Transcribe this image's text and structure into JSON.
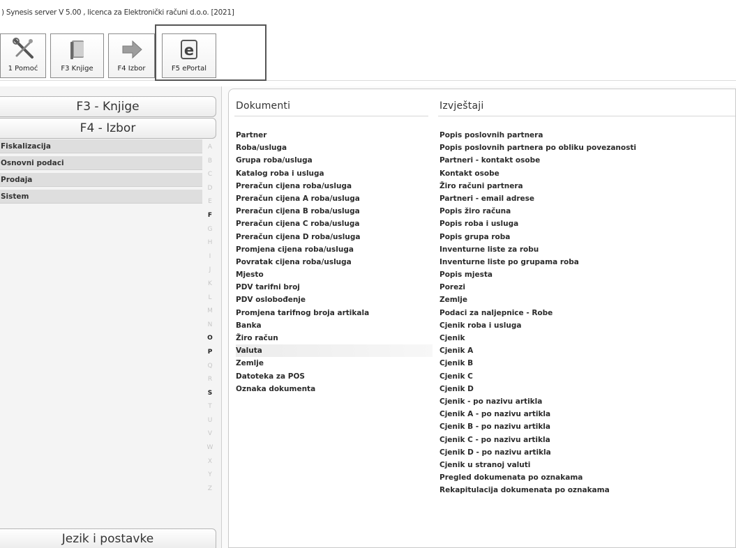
{
  "window": {
    "title": ") Synesis server V 5.00 , licenca za Elektronički računi d.o.o. [2021]"
  },
  "toolbar": {
    "buttons": [
      {
        "label": "1 Pomoć",
        "icon": "wrench-icon"
      },
      {
        "label": "F3 Knjige",
        "icon": "book-icon"
      },
      {
        "label": "F4 Izbor",
        "icon": "arrow-right-icon"
      },
      {
        "label": "F5 ePortal",
        "icon": "eportal-icon"
      }
    ]
  },
  "sidebar": {
    "tab_f3": "F3 - Knjige",
    "tab_f4": "F4 - Izbor",
    "items": [
      {
        "label": "Fiskalizacija"
      },
      {
        "label": "Osnovni podaci"
      },
      {
        "label": "Prodaja"
      },
      {
        "label": "Sistem"
      }
    ],
    "alphabet": [
      "A",
      "B",
      "C",
      "D",
      "E",
      "F",
      "G",
      "H",
      "I",
      "J",
      "K",
      "L",
      "M",
      "N",
      "O",
      "P",
      "Q",
      "R",
      "S",
      "T",
      "U",
      "V",
      "W",
      "X",
      "Y",
      "Z"
    ],
    "active_letters": [
      "F",
      "O",
      "P",
      "S"
    ],
    "bottom_tab": "Jezik i postavke"
  },
  "dokumenti": {
    "heading": "Dokumenti",
    "selected_index": 17,
    "items": [
      "Partner",
      "Roba/usluga",
      "Grupa roba/usluga",
      "Katalog roba i usluga",
      "Preračun cijena roba/usluga",
      "Preračun cijena A roba/usluga",
      "Preračun cijena B roba/usluga",
      "Preračun cijena C roba/usluga",
      "Preračun cijena D roba/usluga",
      "Promjena cijena roba/usluga",
      "Povratak cijena roba/usluga",
      "Mjesto",
      "PDV tarifni broj",
      "PDV oslobođenje",
      "Promjena tarifnog broja artikala",
      "Banka",
      "Žiro račun",
      "Valuta",
      "Zemlje",
      "Datoteka za POS",
      "Oznaka dokumenta"
    ]
  },
  "izvjestaji": {
    "heading": "Izvještaji",
    "items": [
      "Popis poslovnih partnera",
      "Popis poslovnih partnera po obliku povezanosti",
      "Partneri - kontakt osobe",
      "Kontakt osobe",
      "Žiro računi partnera",
      "Partneri - email adrese",
      "Popis žiro računa",
      "Popis roba i usluga",
      "Popis grupa roba",
      "Inventurne liste za robu",
      "Inventurne liste po grupama roba",
      "Popis mjesta",
      "Porezi",
      "Zemlje",
      "Podaci za naljepnice - Robe",
      "Cjenik roba i usluga",
      "Cjenik",
      "Cjenik A",
      "Cjenik B",
      "Cjenik C",
      "Cjenik D",
      "Cjenik - po nazivu artikla",
      "Cjenik A - po nazivu artikla",
      "Cjenik B - po nazivu artikla",
      "Cjenik C - po nazivu artikla",
      "Cjenik D - po nazivu artikla",
      "Cjenik u stranoj valuti",
      "Pregled dokumenata po oznakama",
      "Rekapitulacija dokumenata po oznakama"
    ]
  }
}
